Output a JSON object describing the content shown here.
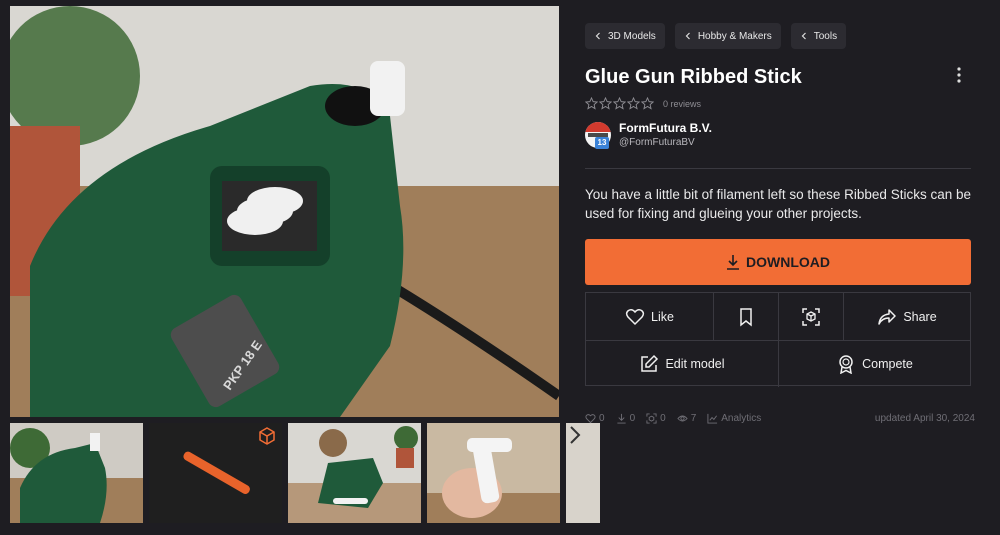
{
  "breadcrumbs": [
    {
      "label": "3D Models"
    },
    {
      "label": "Hobby & Makers"
    },
    {
      "label": "Tools"
    }
  ],
  "model": {
    "title": "Glue Gun Ribbed Stick",
    "reviews": "0 reviews",
    "rating_stars": 0,
    "description": "You have a little bit of filament left so these Ribbed Sticks can be used for fixing and glueing your other projects."
  },
  "author": {
    "name": "FormFutura B.V.",
    "handle": "@FormFuturaBV",
    "level": "13"
  },
  "main_image": {
    "printed_label": "PKP 18 E"
  },
  "download": {
    "label": "DOWNLOAD"
  },
  "actions": {
    "like": "Like",
    "share": "Share",
    "edit": "Edit model",
    "compete": "Compete"
  },
  "stats": {
    "likes": "0",
    "downloads": "0",
    "makes": "0",
    "views": "7",
    "analytics": "Analytics",
    "updated": "updated April 30, 2024"
  },
  "colors": {
    "accent": "#f26d35",
    "background": "#1e1d22",
    "level_badge": "#3b82d6"
  },
  "icons": [
    "chevron-left-icon",
    "more-vertical-icon",
    "star-icon",
    "download-icon",
    "heart-icon",
    "bookmark-icon",
    "3d-view-icon",
    "share-icon",
    "edit-icon",
    "award-icon",
    "download-count-icon",
    "make-icon",
    "eye-icon",
    "analytics-icon",
    "chevron-right-icon",
    "3d-cube-icon"
  ]
}
